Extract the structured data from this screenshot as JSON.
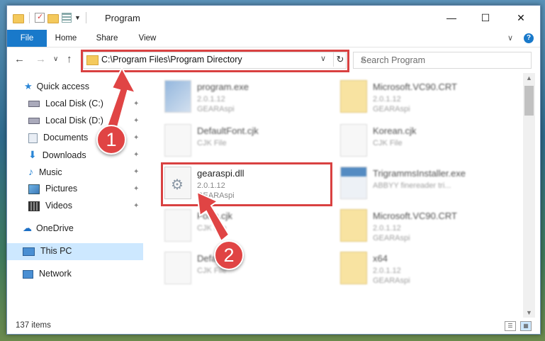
{
  "window": {
    "title": "Program",
    "minimize_glyph": "—",
    "maximize_glyph": "☐",
    "close_glyph": "✕"
  },
  "ribbon": {
    "tabs": [
      "File",
      "Home",
      "Share",
      "View"
    ],
    "collapse_glyph": "∨",
    "help_glyph": "?"
  },
  "address": {
    "path": "C:\\Program Files\\Program Directory",
    "dropdown_glyph": "∨",
    "refresh_glyph": "↻"
  },
  "search": {
    "placeholder": "Search Program",
    "icon": "search-icon"
  },
  "nav_buttons": {
    "back": "←",
    "forward": "→",
    "recent": "∨",
    "up": "↑"
  },
  "sidebar": {
    "items": [
      {
        "label": "Quick access",
        "icon": "star-icon",
        "pinned": false
      },
      {
        "label": "Local Disk (C:)",
        "icon": "drive-icon",
        "pinned": true
      },
      {
        "label": "Local Disk (D:)",
        "icon": "drive-icon",
        "pinned": true
      },
      {
        "label": "Documents",
        "icon": "documents-icon",
        "pinned": true
      },
      {
        "label": "Downloads",
        "icon": "download-icon",
        "pinned": true
      },
      {
        "label": "Music",
        "icon": "music-icon",
        "pinned": true
      },
      {
        "label": "Pictures",
        "icon": "pictures-icon",
        "pinned": true
      },
      {
        "label": "Videos",
        "icon": "videos-icon",
        "pinned": true
      },
      {
        "label": "OneDrive",
        "icon": "cloud-icon",
        "pinned": false
      },
      {
        "label": "This PC",
        "icon": "computer-icon",
        "pinned": false
      },
      {
        "label": "Network",
        "icon": "network-icon",
        "pinned": false
      }
    ],
    "pin_glyph": "📌"
  },
  "files": [
    {
      "name": "program.exe",
      "line2": "2.0.1.12",
      "line3": "GEARAspi",
      "kind": "exe"
    },
    {
      "name": "Microsoft.VC90.CRT",
      "line2": "2.0.1.12",
      "line3": "GEARAspi",
      "kind": "folder"
    },
    {
      "name": "DefaultFont.cjk",
      "line2": "CJK File",
      "line3": "",
      "kind": "file"
    },
    {
      "name": "Korean.cjk",
      "line2": "CJK File",
      "line3": "",
      "kind": "file"
    },
    {
      "name": "gearaspi.dll",
      "line2": "2.0.1.12",
      "line3": "GEARAspi",
      "kind": "dll"
    },
    {
      "name": "TrigrammsInstaller.exe",
      "line2": "ABBYY finereader tri...",
      "line3": "",
      "kind": "exe"
    },
    {
      "name": "Form.cjk",
      "line2": "CJK File",
      "line3": "",
      "kind": "file"
    },
    {
      "name": "Microsoft.VC90.CRT",
      "line2": "2.0.1.12",
      "line3": "GEARAspi",
      "kind": "folder"
    },
    {
      "name": "Default.cjk",
      "line2": "CJK File",
      "line3": "",
      "kind": "file"
    },
    {
      "name": "x64",
      "line2": "2.0.1.12",
      "line3": "GEARAspi",
      "kind": "folder"
    }
  ],
  "status": {
    "count": "137 items"
  },
  "callouts": [
    "1",
    "2"
  ],
  "colors": {
    "accent": "#1979ca",
    "highlight": "#d94141",
    "selected": "#cde8ff"
  }
}
